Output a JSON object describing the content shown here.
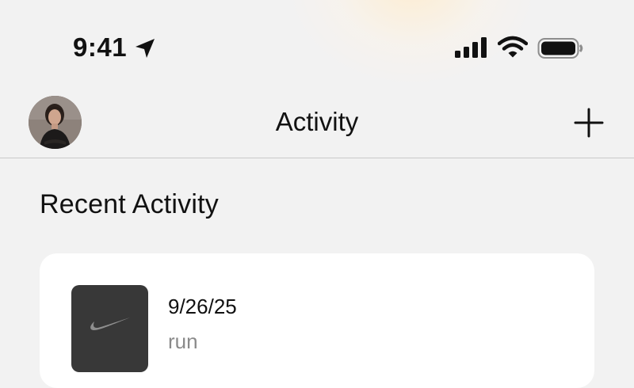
{
  "status_bar": {
    "time": "9:41",
    "icons": [
      "location-arrow-icon",
      "cellular-signal-icon",
      "wifi-icon",
      "battery-icon"
    ]
  },
  "nav": {
    "title": "Activity",
    "avatar": "profile-photo",
    "add_icon": "plus-icon"
  },
  "recent": {
    "heading": "Recent Activity",
    "items": [
      {
        "date": "9/26/25",
        "type": "run",
        "thumbnail_icon": "nike-swoosh-icon"
      }
    ]
  },
  "colors": {
    "background": "#f2f2f2",
    "card": "#ffffff",
    "thumbnail": "#383838",
    "secondary_text": "#8a8a8a",
    "divider": "#c9c9c9"
  }
}
